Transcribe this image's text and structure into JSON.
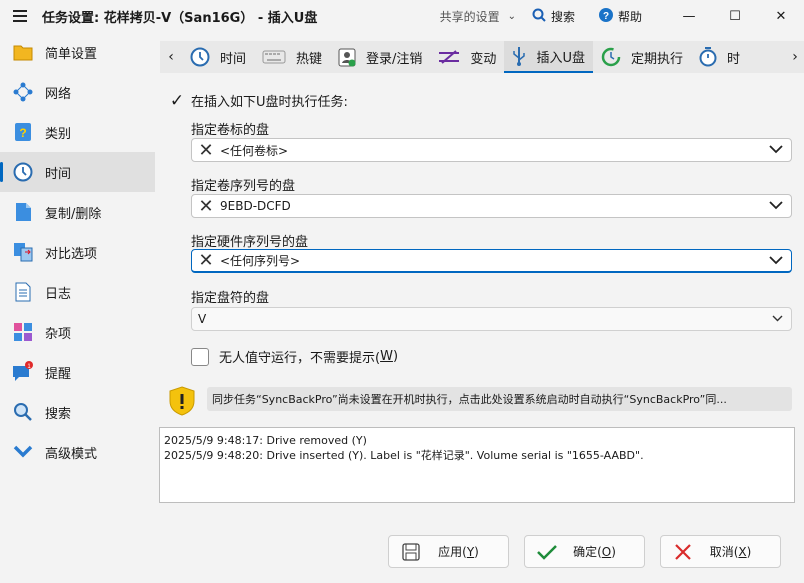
{
  "titlebar": {
    "title": "任务设置: 花样拷贝-V（San16G） - 插入U盘",
    "shared_settings": "共享的设置",
    "search": "搜索",
    "help": "帮助",
    "minimize": "—",
    "maximize": "☐",
    "close": "✕"
  },
  "sidebar": {
    "items": [
      {
        "label": "简单设置",
        "icon": "folder-icon"
      },
      {
        "label": "网络",
        "icon": "network-icon"
      },
      {
        "label": "类别",
        "icon": "category-icon"
      },
      {
        "label": "时间",
        "icon": "clock-icon",
        "active": true
      },
      {
        "label": "复制/删除",
        "icon": "copy-icon"
      },
      {
        "label": "对比选项",
        "icon": "compare-icon"
      },
      {
        "label": "日志",
        "icon": "log-icon"
      },
      {
        "label": "杂项",
        "icon": "misc-icon"
      },
      {
        "label": "提醒",
        "icon": "reminder-icon",
        "badge": "1"
      },
      {
        "label": "搜索",
        "icon": "search-icon"
      },
      {
        "label": "高级模式",
        "icon": "chevron-down-icon"
      }
    ]
  },
  "tabs": {
    "items": [
      {
        "label": "时间",
        "icon": "clock-icon"
      },
      {
        "label": "热键",
        "icon": "keyboard-icon"
      },
      {
        "label": "登录/注销",
        "icon": "login-icon"
      },
      {
        "label": "变动",
        "icon": "change-icon"
      },
      {
        "label": "插入U盘",
        "icon": "usb-icon",
        "active": true
      },
      {
        "label": "定期执行",
        "icon": "refresh-icon"
      },
      {
        "label": "时",
        "icon": "timer-icon"
      }
    ]
  },
  "form": {
    "run_on_insert": "在插入如下U盘时执行任务:",
    "volume_label_label": "指定卷标的盘",
    "volume_label_value": "<任何卷标>",
    "volume_serial_label": "指定卷序列号的盘",
    "volume_serial_value": "9EBD-DCFD",
    "hardware_serial_label": "指定硬件序列号的盘",
    "hardware_serial_value": "<任何序列号>",
    "drive_letter_label": "指定盘符的盘",
    "drive_letter_value": "V",
    "unattended_prefix": "无人值守运行，不需要提示(",
    "unattended_key": "W",
    "unattended_suffix": ")"
  },
  "notice": {
    "text": "同步任务“SyncBackPro”尚未设置在开机时执行，点击此处设置系统启动时自动执行“SyncBackPro”同..."
  },
  "log": {
    "lines": [
      "2025/5/9 9:48:17: Drive removed (Y)",
      "2025/5/9 9:48:20: Drive inserted (Y). Label is \"花样记录\". Volume serial is \"1655-AABD\"."
    ]
  },
  "buttons": {
    "apply": {
      "label": "应用",
      "key": "Y"
    },
    "ok": {
      "label": "确定",
      "key": "O"
    },
    "cancel": {
      "label": "取消",
      "key": "X"
    }
  },
  "colors": {
    "accent": "#0067c0",
    "ok_green": "#1e8c3a",
    "cancel_red": "#d92b2b",
    "shield_yellow": "#f4c20d"
  }
}
